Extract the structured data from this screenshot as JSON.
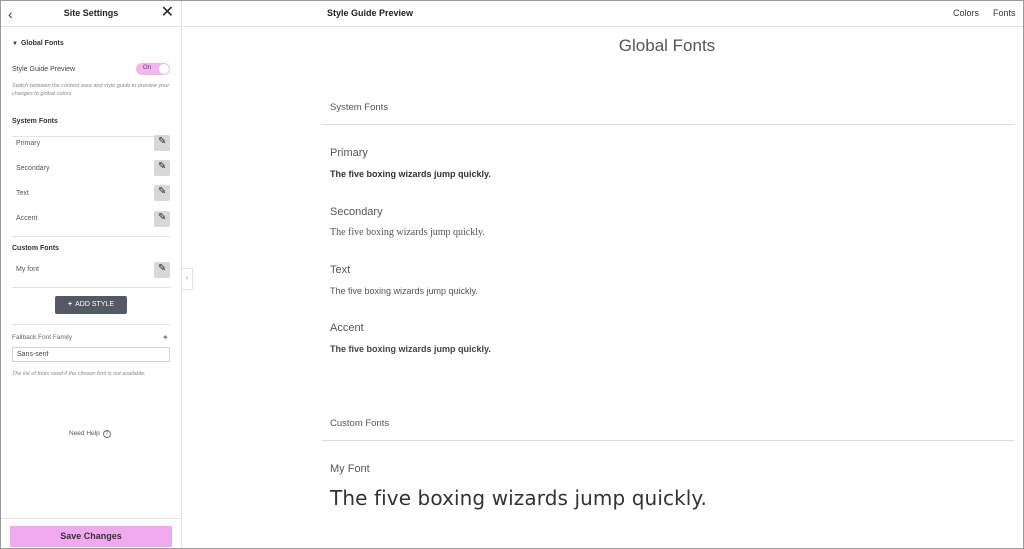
{
  "panel": {
    "back_icon": "chevron-left-icon",
    "title": "Site Settings",
    "close_icon": "close-icon",
    "global_fonts_section": "Global Fonts",
    "style_guide_preview_label": "Style Guide Preview",
    "style_guide_toggle": "On",
    "style_guide_help": "Switch between the content area and style guide to preview your changes to global colors.",
    "system_fonts_title": "System Fonts",
    "system_fonts": [
      {
        "label": "Primary"
      },
      {
        "label": "Secondary"
      },
      {
        "label": "Text"
      },
      {
        "label": "Accent"
      }
    ],
    "custom_fonts_title": "Custom Fonts",
    "custom_fonts": [
      {
        "label": "My font"
      }
    ],
    "add_style_label": "ADD STYLE",
    "fallback_label": "Fallback Font Family",
    "fallback_value": "Sans-serif",
    "fallback_help": "The list of fonts used if the chosen font is not available.",
    "need_help": "Need Help",
    "save_label": "Save Changes"
  },
  "topbar": {
    "title": "Style Guide Preview",
    "colors": "Colors",
    "fonts": "Fonts"
  },
  "main": {
    "title": "Global Fonts",
    "system_fonts_title": "System Fonts",
    "system_fonts": [
      {
        "name": "Primary",
        "sample": "The five boxing wizards jump quickly."
      },
      {
        "name": "Secondary",
        "sample": "The five boxing wizards jump quickly."
      },
      {
        "name": "Text",
        "sample": "The five boxing wizards jump quickly."
      },
      {
        "name": "Accent",
        "sample": "The five boxing wizards jump quickly."
      }
    ],
    "custom_fonts_title": "Custom Fonts",
    "custom_fonts": [
      {
        "name": "My Font",
        "sample": "The five boxing wizards jump quickly."
      }
    ]
  },
  "colors": {
    "accent_pink": "#f0a8ef",
    "toggle_bg": "#f0b6ee",
    "add_style_bg": "#545a64"
  }
}
